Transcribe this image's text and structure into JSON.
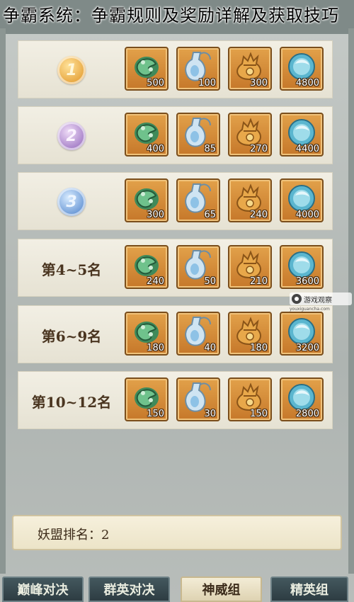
{
  "caption": "争霸系统：争霸规则及奖励详解及获取技巧",
  "ranks": [
    {
      "type": "medal",
      "medal": "gold",
      "label": "1",
      "rewards": [
        "500",
        "100",
        "300",
        "4800"
      ]
    },
    {
      "type": "medal",
      "medal": "silver",
      "label": "2",
      "rewards": [
        "400",
        "85",
        "270",
        "4400"
      ]
    },
    {
      "type": "medal",
      "medal": "bronze",
      "label": "3",
      "rewards": [
        "300",
        "65",
        "240",
        "4000"
      ]
    },
    {
      "type": "text",
      "label": "第4~5名",
      "rewards": [
        "240",
        "50",
        "210",
        "3600"
      ]
    },
    {
      "type": "text",
      "label": "第6~9名",
      "rewards": [
        "180",
        "40",
        "180",
        "3200"
      ]
    },
    {
      "type": "text",
      "label": "第10~12名",
      "rewards": [
        "150",
        "30",
        "150",
        "2800"
      ]
    }
  ],
  "reward_icons": [
    "jade-dragon-icon",
    "gourd-bottle-icon",
    "fortune-pouch-icon",
    "spirit-orb-icon"
  ],
  "league_rank": "妖盟排名：2",
  "watermark": {
    "text": "游戏观察",
    "sub": "youxiguancha.com"
  },
  "tabs": [
    {
      "label": "巅峰对决",
      "active": false
    },
    {
      "label": "群英对决",
      "active": false
    },
    {
      "label": "神威组",
      "active": true
    },
    {
      "label": "精英组",
      "active": false
    }
  ],
  "colors": {
    "accent": "#c6782a",
    "tab_dark": "#2d3c42",
    "panel": "#f2efe4"
  }
}
